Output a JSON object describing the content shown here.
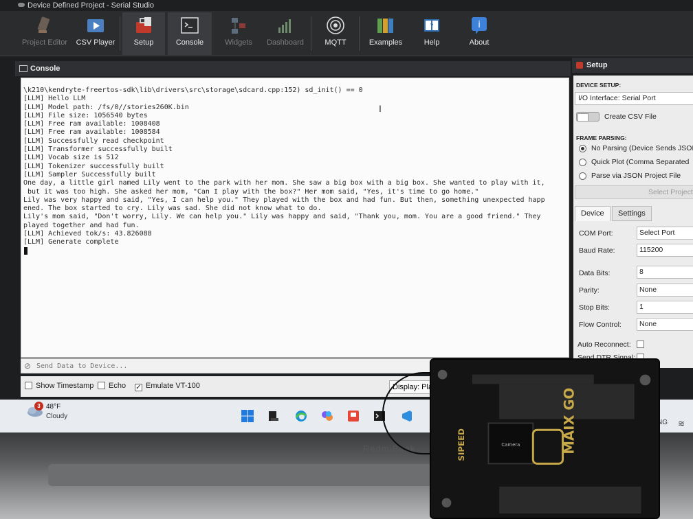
{
  "window": {
    "title": "Device Defined Project - Serial Studio"
  },
  "toolbar": {
    "items": [
      {
        "label": "Project Editor",
        "icon": "pencil-icon",
        "enabled": false
      },
      {
        "label": "CSV Player",
        "icon": "play-icon",
        "enabled": true
      },
      {
        "label": "Setup",
        "icon": "toolbox-icon",
        "enabled": true,
        "active": true
      },
      {
        "label": "Console",
        "icon": "terminal-icon",
        "enabled": true,
        "active": true
      },
      {
        "label": "Widgets",
        "icon": "widgets-icon",
        "enabled": false
      },
      {
        "label": "Dashboard",
        "icon": "dashboard-icon",
        "enabled": false
      },
      {
        "label": "MQTT",
        "icon": "broadcast-icon",
        "enabled": true
      },
      {
        "label": "Examples",
        "icon": "books-icon",
        "enabled": true
      },
      {
        "label": "Help",
        "icon": "help-book-icon",
        "enabled": true
      },
      {
        "label": "About",
        "icon": "info-icon",
        "enabled": true
      }
    ]
  },
  "console": {
    "title": "Console",
    "lines": [
      "\\k210\\kendryte-freertos-sdk\\lib\\drivers\\src\\storage\\sdcard.cpp:152) sd_init() == 0",
      "[LLM] Hello LLM",
      "[LLM] Model path: /fs/0//stories260K.bin",
      "[LLM] File size: 1056540 bytes",
      "[LLM] Free ram available: 1008408",
      "[LLM] Free ram available: 1008584",
      "[LLM] Successfully read checkpoint",
      "[LLM] Transformer successfully built",
      "[LLM] Vocab size is 512",
      "[LLM] Tokenizer successfully built",
      "[LLM] Sampler Successfully built",
      "One day, a little girl named Lily went to the park with her mom. She saw a big box with a big box. She wanted to play with it,",
      " but it was too high. She asked her mom, \"Can I play with the box?\" Her mom said, \"Yes, it's time to go home.\"",
      "Lily was very happy and said, \"Yes, I can help you.\" They played with the box and had fun. But then, something unexpected happ",
      "ened. The box started to cry. Lily was sad. She did not know what to do.",
      "Lily's mom said, \"Don't worry, Lily. We can help you.\" Lily was happy and said, \"Thank you, mom. You are a good friend.\" They",
      "played together and had fun.",
      "[LLM] Achieved tok/s: 43.826088",
      "[LLM] Generate complete"
    ],
    "send_placeholder": "Send Data to Device...",
    "options": {
      "show_timestamp": {
        "label": "Show Timestamp",
        "checked": false
      },
      "echo": {
        "label": "Echo",
        "checked": false
      },
      "emulate_vt100": {
        "label": "Emulate VT-100",
        "checked": true
      },
      "display": "Display: Pla"
    }
  },
  "setup": {
    "title": "Setup",
    "device_setup_label": "DEVICE SETUP:",
    "io_interface": "I/O Interface: Serial Port",
    "create_csv": "Create CSV File",
    "frame_parsing_label": "FRAME PARSING:",
    "parsing_options": [
      {
        "label": "No Parsing (Device Sends JSON",
        "selected": true
      },
      {
        "label": "Quick Plot (Comma Separated",
        "selected": false
      },
      {
        "label": "Parse via JSON Project File",
        "selected": false
      }
    ],
    "select_project": "Select Project",
    "tabs": [
      "Device",
      "Settings"
    ],
    "fields": [
      {
        "label": "COM Port:",
        "value": "Select Port"
      },
      {
        "label": "Baud Rate:",
        "value": "115200"
      },
      {
        "label": "Data Bits:",
        "value": "8"
      },
      {
        "label": "Parity:",
        "value": "None"
      },
      {
        "label": "Stop Bits:",
        "value": "1"
      },
      {
        "label": "Flow Control:",
        "value": "None"
      }
    ],
    "auto_reconnect": "Auto Reconnect:",
    "send_dtr": "Send DTR Signal:"
  },
  "taskbar": {
    "weather_badge": "3",
    "temperature": "48°F",
    "condition": "Cloudy",
    "language": "NG",
    "icons": [
      "windows-start-icon",
      "file-explorer-icon",
      "edge-icon",
      "copilot-icon",
      "app-icon",
      "terminal-icon",
      "vscode-icon"
    ]
  },
  "board": {
    "brand": "SIPEED",
    "model": "MAIX GO",
    "camera_label": "Camera"
  },
  "laptop": {
    "brand": "RedmiBook"
  }
}
